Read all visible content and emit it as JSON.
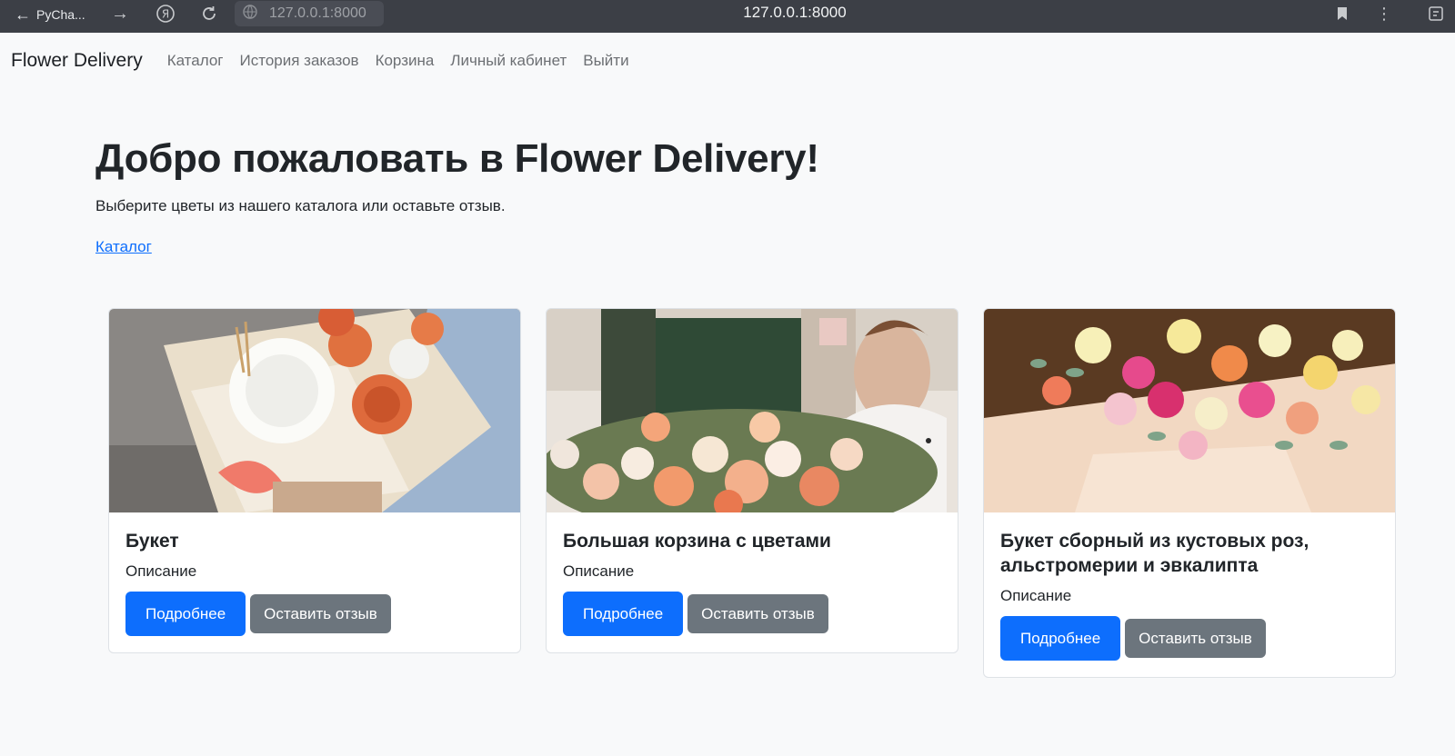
{
  "browser": {
    "tab_title": "PyCha...",
    "address_chip": "127.0.0.1:8000",
    "center_url": "127.0.0.1:8000"
  },
  "navbar": {
    "brand": "Flower Delivery",
    "links": [
      "Каталог",
      "История заказов",
      "Корзина",
      "Личный кабинет",
      "Выйти"
    ]
  },
  "hero": {
    "title": "Добро пожаловать в Flower Delivery!",
    "subtitle": "Выберите цветы из нашего каталога или оставьте отзыв.",
    "link": "Каталог"
  },
  "cards": [
    {
      "title": "Букет",
      "description": "Описание",
      "details_label": "Подробнее",
      "review_label": "Оставить отзыв"
    },
    {
      "title": "Большая корзина с цветами",
      "description": "Описание",
      "details_label": "Подробнее",
      "review_label": "Оставить отзыв"
    },
    {
      "title": "Букет сборный из кустовых роз, альстромерии и эвкалипта",
      "description": "Описание",
      "details_label": "Подробнее",
      "review_label": "Оставить отзыв"
    }
  ],
  "colors": {
    "primary": "#0d6efd",
    "secondary": "#6c757d",
    "background": "#f8f9fa",
    "chrome": "#3c3f46"
  }
}
